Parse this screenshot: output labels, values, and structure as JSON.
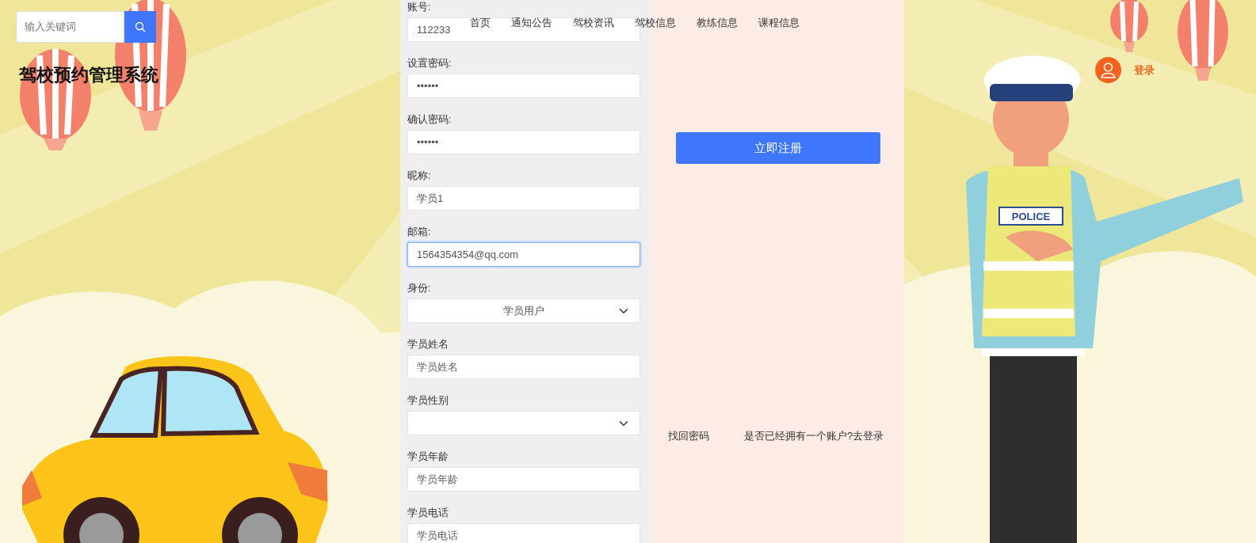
{
  "search": {
    "placeholder": "输入关键词"
  },
  "site_title": "驾校预约管理系统",
  "nav": [
    {
      "label": "首页"
    },
    {
      "label": "通知公告"
    },
    {
      "label": "驾校资讯"
    },
    {
      "label": "驾校信息"
    },
    {
      "label": "教练信息"
    },
    {
      "label": "课程信息"
    }
  ],
  "form": {
    "fields": [
      {
        "label": "账号:",
        "kind": "text",
        "value": "112233",
        "focused": false
      },
      {
        "label": "设置密码:",
        "kind": "text",
        "value": "••••••",
        "focused": false
      },
      {
        "label": "确认密码:",
        "kind": "text",
        "value": "••••••",
        "focused": false
      },
      {
        "label": "昵称:",
        "kind": "text",
        "value": "学员1",
        "focused": false
      },
      {
        "label": "邮箱:",
        "kind": "text",
        "value": "1564354354@qq.com",
        "focused": true
      },
      {
        "label": "身份:",
        "kind": "select",
        "value": "学员用户",
        "focused": false
      },
      {
        "label": "学员姓名",
        "kind": "text",
        "placeholder": "学员姓名",
        "focused": false
      },
      {
        "label": "学员性别",
        "kind": "select",
        "focused": false
      },
      {
        "label": "学员年龄",
        "kind": "text",
        "placeholder": "学员年龄",
        "focused": false
      },
      {
        "label": "学员电话",
        "kind": "text",
        "placeholder": "学员电话",
        "focused": false
      }
    ]
  },
  "register_button": "立即注册",
  "links": [
    "找回密码",
    "是否已经拥有一个账户?去登录"
  ],
  "login": {
    "label": "登录"
  },
  "illustration": {
    "vest_label": "POLICE"
  }
}
